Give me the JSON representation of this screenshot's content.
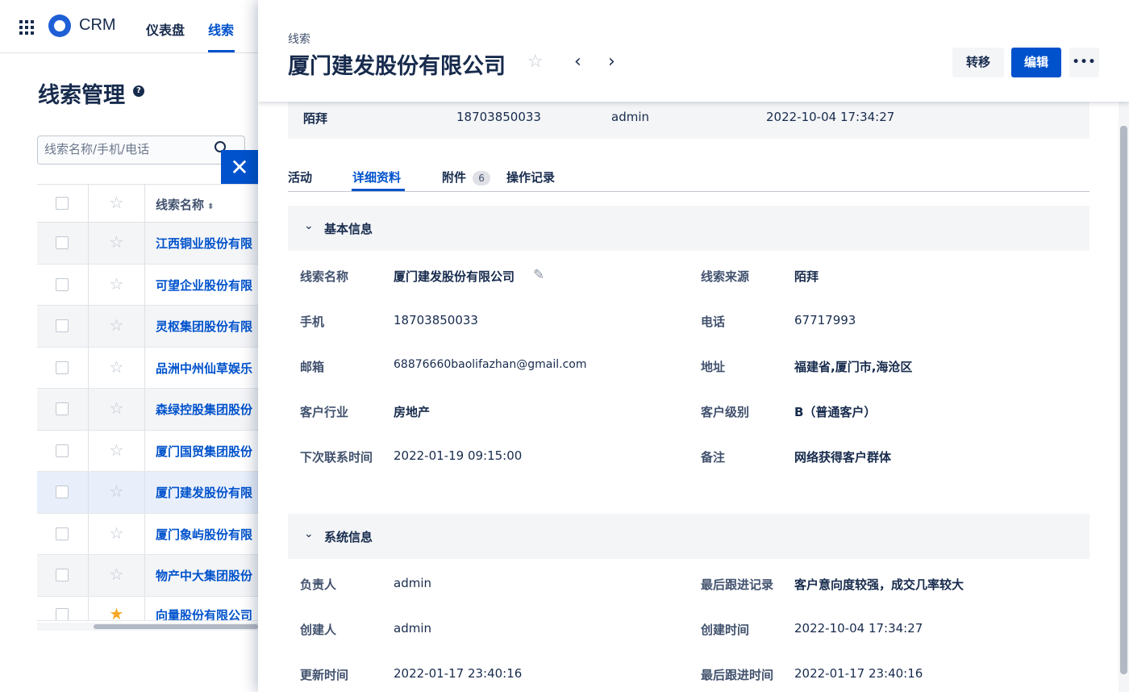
{
  "topnav": {
    "brand": "CRM",
    "items": [
      {
        "label": "仪表盘"
      },
      {
        "label": "线索"
      }
    ]
  },
  "list_page": {
    "title": "线索管理",
    "help_glyph": "?",
    "search": {
      "placeholder": "线索名称/手机/电话",
      "value": ""
    },
    "close_glyph": "✕",
    "column_name": "线索名称",
    "rows": [
      {
        "name": "江西铜业股份有限",
        "starred": false
      },
      {
        "name": "可望企业股份有限",
        "starred": false
      },
      {
        "name": "灵枢集团股份有限",
        "starred": false
      },
      {
        "name": "品洲中州仙草娱乐",
        "starred": false
      },
      {
        "name": "森绿控股集团股份",
        "starred": false
      },
      {
        "name": "厦门国贸集团股份",
        "starred": false
      },
      {
        "name": "厦门建发股份有限",
        "starred": false,
        "selected": true
      },
      {
        "name": "厦门象屿股份有限",
        "starred": false
      },
      {
        "name": "物产中大集团股份",
        "starred": false
      },
      {
        "name": "向量股份有限公司",
        "starred": true
      }
    ]
  },
  "drawer": {
    "breadcrumb": "线索",
    "title": "厦门建发股份有限公司",
    "buttons": {
      "transfer": "转移",
      "edit": "编辑",
      "more": "•••"
    },
    "summary": {
      "source": "陌拜",
      "phone": "18703850033",
      "owner": "admin",
      "created": "2022-10-04 17:34:27"
    },
    "tabs": [
      {
        "label": "活动"
      },
      {
        "label": "详细资料"
      },
      {
        "label": "附件",
        "count": "6"
      },
      {
        "label": "操作记录"
      }
    ],
    "basic": {
      "title": "基本信息",
      "lead_name_label": "线索名称",
      "lead_name": "厦门建发股份有限公司",
      "source_label": "线索来源",
      "source": "陌拜",
      "mobile_label": "手机",
      "mobile": "18703850033",
      "tel_label": "电话",
      "tel": "67717993",
      "email_label": "邮箱",
      "email": "68876660baolifazhan@gmail.com",
      "address_label": "地址",
      "address": "福建省,厦门市,海沧区",
      "industry_label": "客户行业",
      "industry": "房地产",
      "level_label": "客户级别",
      "level": "B（普通客户）",
      "next_contact_label": "下次联系时间",
      "next_contact": "2022-01-19 09:15:00",
      "remark_label": "备注",
      "remark": "网络获得客户群体"
    },
    "system": {
      "title": "系统信息",
      "owner_label": "负责人",
      "owner": "admin",
      "last_follow_label": "最后跟进记录",
      "last_follow": "客户意向度较强，成交几率较大",
      "creator_label": "创建人",
      "creator": "admin",
      "created_label": "创建时间",
      "created": "2022-10-04 17:34:27",
      "updated_label": "更新时间",
      "updated": "2022-01-17 23:40:16",
      "last_follow_time_label": "最后跟进时间",
      "last_follow_time": "2022-01-17 23:40:16"
    }
  }
}
